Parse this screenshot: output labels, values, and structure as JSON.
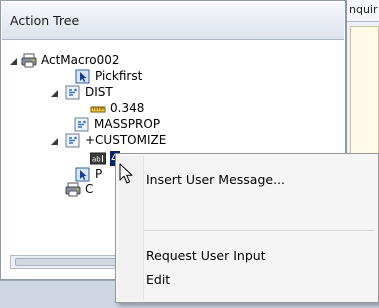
{
  "panel": {
    "title": "Action Tree"
  },
  "right_panel": {
    "header_text": "nquir"
  },
  "tree": {
    "items": [
      {
        "label": "ActMacro002",
        "icon": "macro-icon"
      },
      {
        "label": "Pickfirst",
        "icon": "select-action-icon"
      },
      {
        "label": "DIST",
        "icon": "command-icon"
      },
      {
        "label": "0.348",
        "icon": "measure-icon"
      },
      {
        "label": "MASSPROP",
        "icon": "command-icon"
      },
      {
        "label": "+CUSTOMIZE",
        "icon": "command-icon"
      },
      {
        "label": "4",
        "icon": "text-value-icon"
      },
      {
        "label": "P",
        "icon": "select-action-icon"
      },
      {
        "label": "C",
        "icon": "macro-icon"
      }
    ]
  },
  "context_menu": {
    "items": [
      {
        "label": "Insert User Message..."
      },
      {
        "label": "Request User Input"
      },
      {
        "label": "Edit"
      }
    ]
  },
  "colors": {
    "selection": "#0a246a",
    "header_gradient_top": "#f6f8fb",
    "header_gradient_bottom": "#dde3ec",
    "menu_background": "#f5f5f5"
  }
}
